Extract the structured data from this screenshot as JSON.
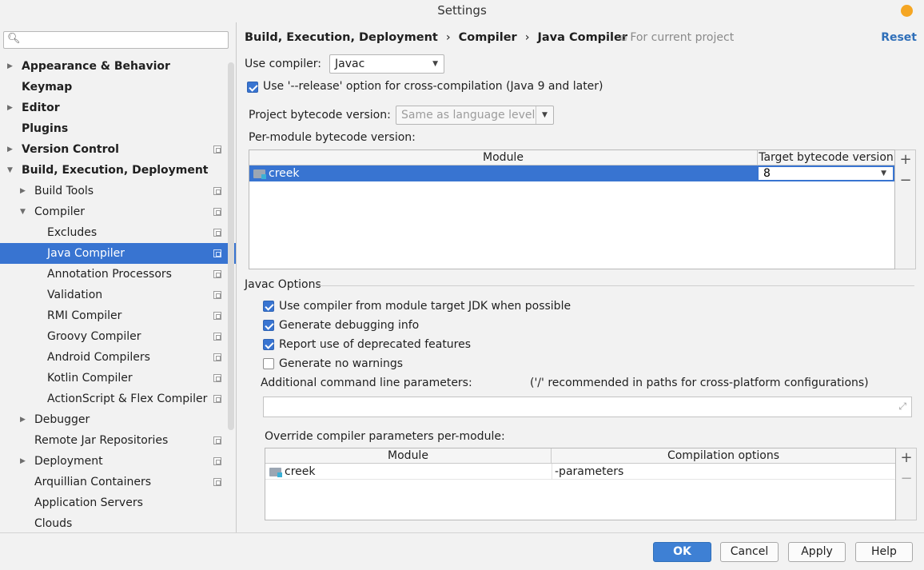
{
  "window": {
    "title": "Settings"
  },
  "sidebar": {
    "search_placeholder": "",
    "items": [
      {
        "label": "Appearance & Behavior",
        "level": 0,
        "bold": true,
        "arrow": "right",
        "proj": false
      },
      {
        "label": "Keymap",
        "level": 0,
        "bold": true,
        "arrow": "",
        "proj": false
      },
      {
        "label": "Editor",
        "level": 0,
        "bold": true,
        "arrow": "right",
        "proj": false
      },
      {
        "label": "Plugins",
        "level": 0,
        "bold": true,
        "arrow": "",
        "proj": false
      },
      {
        "label": "Version Control",
        "level": 0,
        "bold": true,
        "arrow": "right",
        "proj": true
      },
      {
        "label": "Build, Execution, Deployment",
        "level": 0,
        "bold": true,
        "arrow": "down",
        "proj": false
      },
      {
        "label": "Build Tools",
        "level": 1,
        "bold": false,
        "arrow": "right",
        "proj": true
      },
      {
        "label": "Compiler",
        "level": 1,
        "bold": false,
        "arrow": "down",
        "proj": true
      },
      {
        "label": "Excludes",
        "level": 2,
        "bold": false,
        "arrow": "",
        "proj": true
      },
      {
        "label": "Java Compiler",
        "level": 2,
        "bold": false,
        "arrow": "",
        "proj": true,
        "selected": true
      },
      {
        "label": "Annotation Processors",
        "level": 2,
        "bold": false,
        "arrow": "",
        "proj": true
      },
      {
        "label": "Validation",
        "level": 2,
        "bold": false,
        "arrow": "",
        "proj": true
      },
      {
        "label": "RMI Compiler",
        "level": 2,
        "bold": false,
        "arrow": "",
        "proj": true
      },
      {
        "label": "Groovy Compiler",
        "level": 2,
        "bold": false,
        "arrow": "",
        "proj": true
      },
      {
        "label": "Android Compilers",
        "level": 2,
        "bold": false,
        "arrow": "",
        "proj": true
      },
      {
        "label": "Kotlin Compiler",
        "level": 2,
        "bold": false,
        "arrow": "",
        "proj": true
      },
      {
        "label": "ActionScript & Flex Compiler",
        "level": 2,
        "bold": false,
        "arrow": "",
        "proj": true
      },
      {
        "label": "Debugger",
        "level": 1,
        "bold": false,
        "arrow": "right",
        "proj": false
      },
      {
        "label": "Remote Jar Repositories",
        "level": 1,
        "bold": false,
        "arrow": "",
        "proj": true
      },
      {
        "label": "Deployment",
        "level": 1,
        "bold": false,
        "arrow": "right",
        "proj": true
      },
      {
        "label": "Arquillian Containers",
        "level": 1,
        "bold": false,
        "arrow": "",
        "proj": true
      },
      {
        "label": "Application Servers",
        "level": 1,
        "bold": false,
        "arrow": "",
        "proj": false
      },
      {
        "label": "Clouds",
        "level": 1,
        "bold": false,
        "arrow": "",
        "proj": false
      }
    ]
  },
  "breadcrumb": {
    "items": [
      "Build, Execution, Deployment",
      "Compiler",
      "Java Compiler"
    ],
    "separator": "›"
  },
  "for_current_project": "For current project",
  "reset": "Reset",
  "use_compiler": {
    "label": "Use compiler:",
    "value": "Javac"
  },
  "release_option": {
    "label": "Use '--release' option for cross-compilation (Java 9 and later)",
    "checked": true
  },
  "project_bytecode": {
    "label": "Project bytecode version:",
    "value": "Same as language level"
  },
  "per_module": {
    "label": "Per-module bytecode version:",
    "headers": [
      "Module",
      "Target bytecode version"
    ],
    "rows": [
      {
        "module": "creek",
        "target": "8"
      }
    ]
  },
  "javac_options": {
    "title": "Javac Options",
    "options": [
      {
        "label": "Use compiler from module target JDK when possible",
        "checked": true
      },
      {
        "label": "Generate debugging info",
        "checked": true
      },
      {
        "label": "Report use of deprecated features",
        "checked": true
      },
      {
        "label": "Generate no warnings",
        "checked": false
      }
    ],
    "additional_label": "Additional command line parameters:",
    "additional_hint": "('/' recommended in paths for cross-platform configurations)",
    "additional_value": ""
  },
  "override": {
    "label": "Override compiler parameters per-module:",
    "headers": [
      "Module",
      "Compilation options"
    ],
    "rows": [
      {
        "module": "creek",
        "options": "-parameters"
      }
    ]
  },
  "buttons": {
    "ok": "OK",
    "cancel": "Cancel",
    "apply": "Apply",
    "help": "Help"
  },
  "table_buttons": {
    "add": "+",
    "remove": "−"
  },
  "colors": {
    "accent": "#3874d1",
    "link": "#2f6fb9",
    "traffic_light": "#f5a623"
  }
}
